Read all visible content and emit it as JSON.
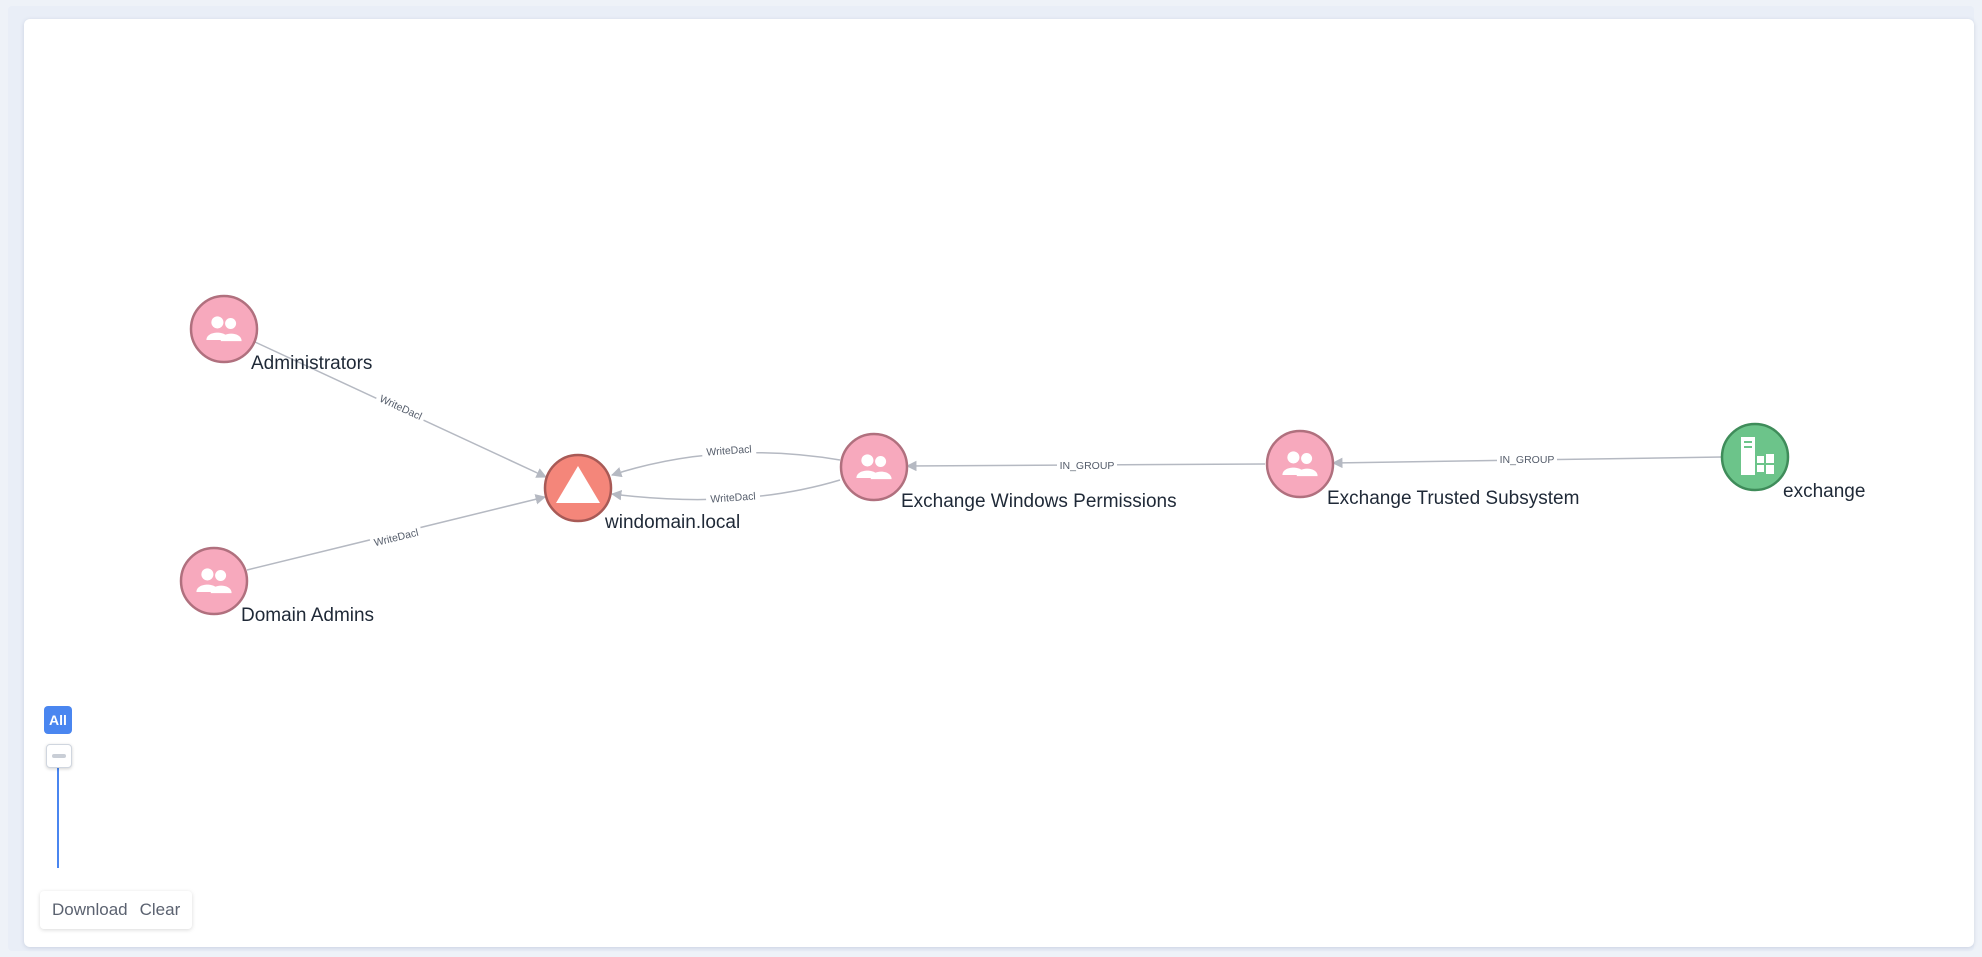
{
  "graph": {
    "nodes": [
      {
        "id": "administrators",
        "label": "Administrators",
        "kind": "group",
        "icon": "users-icon"
      },
      {
        "id": "domain-admins",
        "label": "Domain Admins",
        "kind": "group",
        "icon": "users-icon"
      },
      {
        "id": "windomain",
        "label": "windomain.local",
        "kind": "domain",
        "icon": "triangle-icon"
      },
      {
        "id": "ewp",
        "label": "Exchange Windows Permissions",
        "kind": "group",
        "icon": "users-icon"
      },
      {
        "id": "ets",
        "label": "Exchange Trusted Subsystem",
        "kind": "group",
        "icon": "users-icon"
      },
      {
        "id": "exchange",
        "label": "exchange",
        "kind": "computer",
        "icon": "windows-computer-icon"
      }
    ],
    "edges": [
      {
        "from": "administrators",
        "to": "windomain",
        "label": "WriteDacl"
      },
      {
        "from": "domain-admins",
        "to": "windomain",
        "label": "WriteDacl"
      },
      {
        "from": "ewp",
        "to": "windomain",
        "label": "WriteDacl"
      },
      {
        "from": "ewp",
        "to": "windomain",
        "label": "WriteDacl"
      },
      {
        "from": "ets",
        "to": "ewp",
        "label": "IN_GROUP"
      },
      {
        "from": "exchange",
        "to": "ets",
        "label": "IN_GROUP"
      }
    ]
  },
  "colors": {
    "group": "#f7a9bd",
    "group_border": "#b0707e",
    "domain": "#f4867a",
    "domain_border": "#a85a56",
    "computer": "#6cc48a",
    "computer_border": "#3f8c5a",
    "edge": "#b5b9c2",
    "accent": "#4a86f0"
  },
  "controls": {
    "filter_all_label": "All",
    "download_label": "Download",
    "clear_label": "Clear"
  }
}
